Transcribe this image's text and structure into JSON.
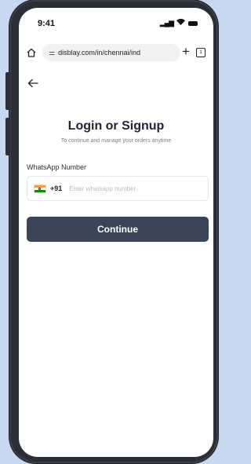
{
  "status_bar": {
    "time": "9:41"
  },
  "browser": {
    "url": "disblay.com/in/chennai/ind",
    "tab_count": "1"
  },
  "login": {
    "title": "Login or Signup",
    "subtitle": "To continue and manage your orders anytime",
    "whatsapp_label": "WhatsApp Number",
    "country_code": "+91",
    "phone_placeholder": "Enter whatsapp number",
    "phone_value": "",
    "continue_label": "Continue"
  },
  "colors": {
    "background": "#c8d8f0",
    "phone_frame": "#2b2e36",
    "button": "#3a4558"
  },
  "icons": [
    "home-icon",
    "tune-icon",
    "plus-icon",
    "tabs-icon",
    "menu-icon",
    "back-arrow-icon",
    "india-flag-icon",
    "signal-icon",
    "wifi-icon",
    "battery-icon"
  ]
}
